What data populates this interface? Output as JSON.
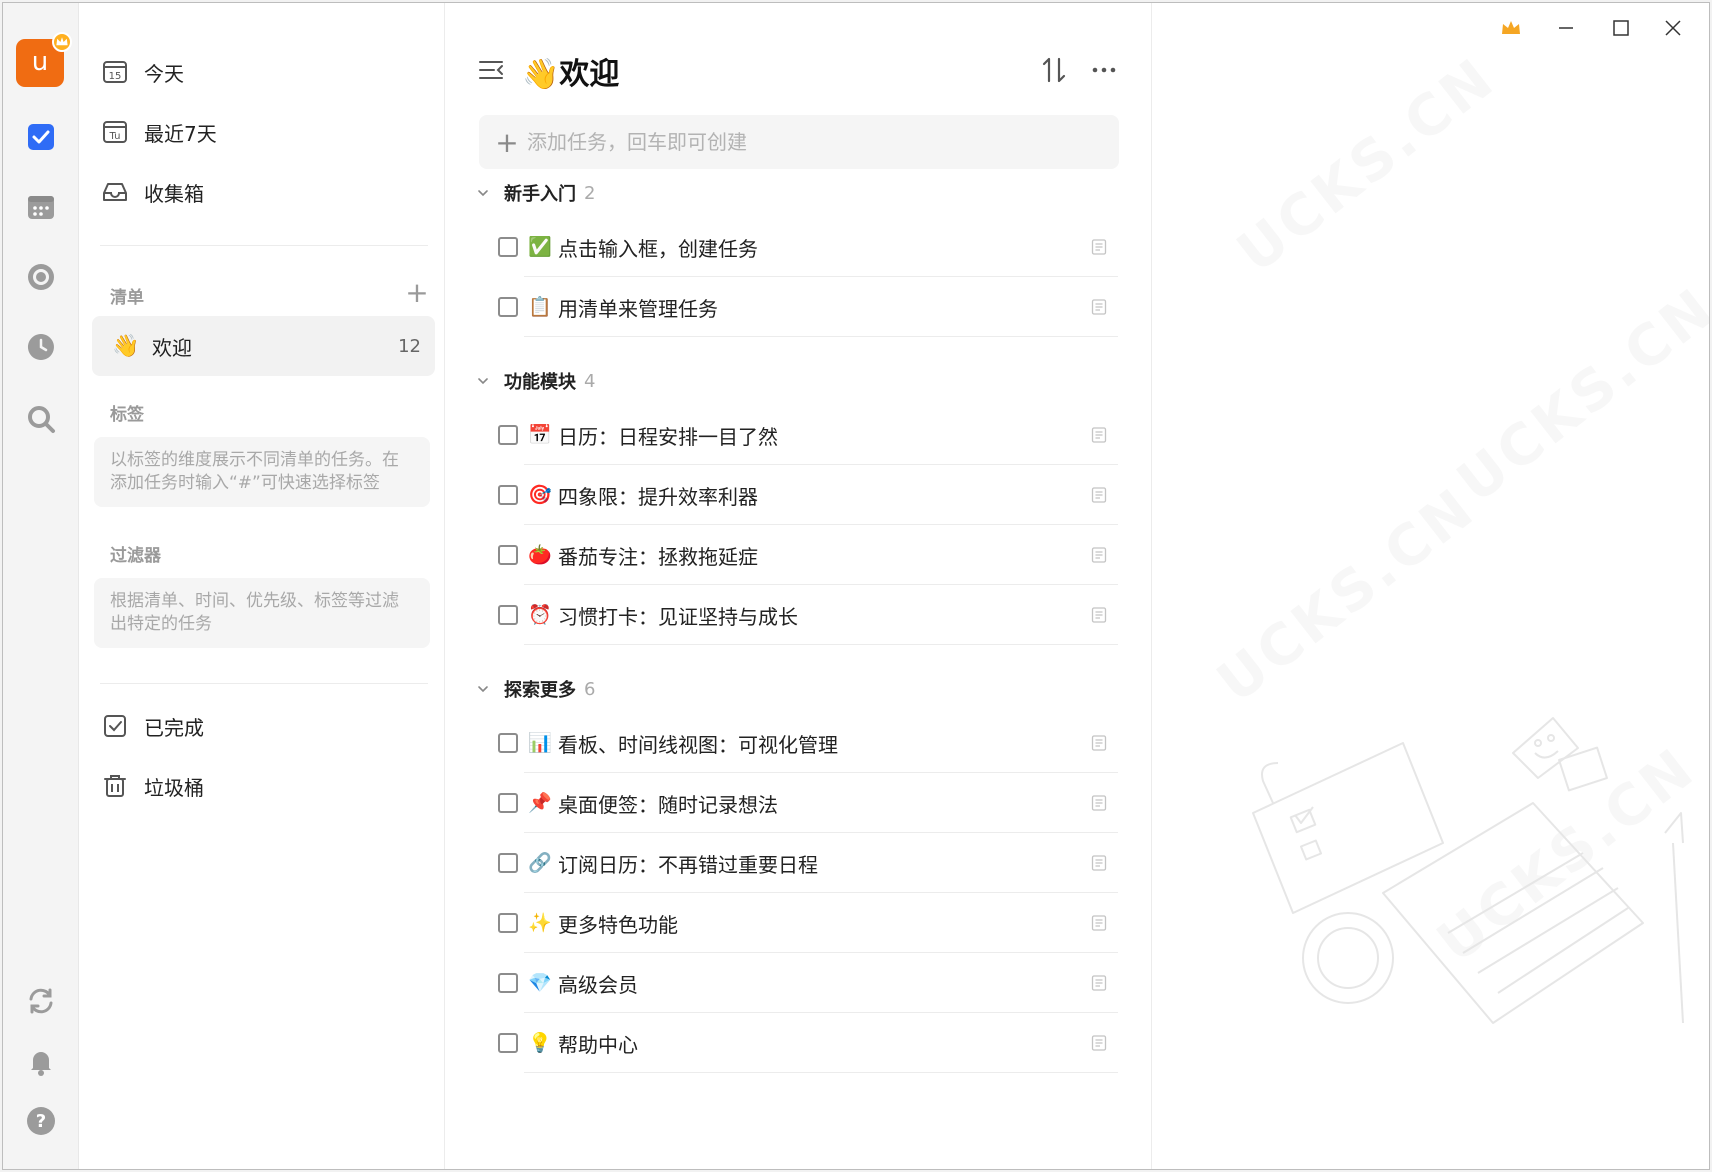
{
  "rail": {
    "avatar_letter": "u",
    "accent_color": "#f06c12",
    "active_color": "#2f6cf6",
    "icons": [
      "task-icon",
      "calendar-icon",
      "focus-icon",
      "clock-icon",
      "search-icon",
      "sync-icon",
      "bell-icon",
      "help-icon"
    ]
  },
  "sidebar": {
    "smart_lists": [
      {
        "label": "今天",
        "icon": "calendar-15-icon"
      },
      {
        "label": "最近7天",
        "icon": "calendar-tu-icon"
      },
      {
        "label": "收集箱",
        "icon": "inbox-icon"
      }
    ],
    "lists_title": "清单",
    "list": {
      "emoji": "👋",
      "label": "欢迎",
      "count": "12"
    },
    "tags_title": "标签",
    "tags_hint": "以标签的维度展示不同清单的任务。在添加任务时输入“#”可快速选择标签",
    "filters_title": "过滤器",
    "filters_hint": "根据清单、时间、优先级、标签等过滤出特定的任务",
    "bottom": [
      {
        "label": "已完成",
        "icon": "completed-icon"
      },
      {
        "label": "垃圾桶",
        "icon": "trash-icon"
      }
    ]
  },
  "main": {
    "title": "👋欢迎",
    "add_placeholder": "添加任务，回车即可创建",
    "groups": [
      {
        "title": "新手入门",
        "count": "2",
        "tasks": [
          {
            "emoji": "✅",
            "label": "点击输入框，创建任务"
          },
          {
            "emoji": "📋",
            "label": "用清单来管理任务"
          }
        ]
      },
      {
        "title": "功能模块",
        "count": "4",
        "tasks": [
          {
            "emoji": "📅",
            "label": "日历：日程安排一目了然"
          },
          {
            "emoji": "🎯",
            "label": "四象限：提升效率利器"
          },
          {
            "emoji": "🍅",
            "label": "番茄专注：拯救拖延症"
          },
          {
            "emoji": "⏰",
            "label": "习惯打卡：见证坚持与成长"
          }
        ]
      },
      {
        "title": "探索更多",
        "count": "6",
        "tasks": [
          {
            "emoji": "📊",
            "label": "看板、时间线视图：可视化管理"
          },
          {
            "emoji": "📌",
            "label": "桌面便签：随时记录想法"
          },
          {
            "emoji": "🔗",
            "label": "订阅日历：不再错过重要日程"
          },
          {
            "emoji": "✨",
            "label": "更多特色功能"
          },
          {
            "emoji": "💎",
            "label": "高级会员"
          },
          {
            "emoji": "💡",
            "label": "帮助中心"
          }
        ]
      }
    ]
  },
  "detail": {
    "watermark": "UCKS.CN",
    "crown_color": "#f5a623"
  }
}
